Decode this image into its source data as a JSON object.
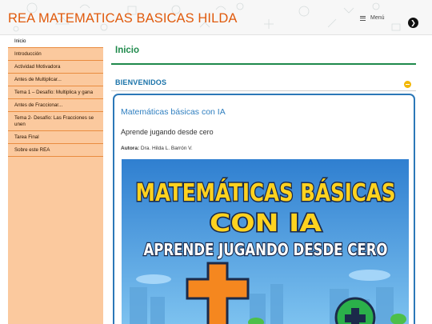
{
  "header": {
    "site_title": "REA MATEMATICAS BASICAS HILDA",
    "menu_label": "Menú",
    "next_icon": "arrow-right-icon"
  },
  "sidebar": {
    "items": [
      {
        "label": "Inicio",
        "active": true
      },
      {
        "label": "Introducción"
      },
      {
        "label": "Actividad Motivadora"
      },
      {
        "label": "Antes de Multiplicar..."
      },
      {
        "label": "Tema 1 – Desafío: Multiplica y gana"
      },
      {
        "label": "Antes de Fraccionar..."
      },
      {
        "label": "Tema 2- Desafío: Las Fracciones se unen"
      },
      {
        "label": "Tarea Final"
      },
      {
        "label": "Sobre este REA"
      }
    ]
  },
  "main": {
    "page_title": "Inicio",
    "section_title": "BIENVENIDOS",
    "card": {
      "title": "Matemáticas básicas con IA",
      "subtitle": "Aprende jugando desde cero",
      "author_label": "Autora:",
      "author_name": "Dra. Hilda L. Barrón V."
    },
    "cover": {
      "line1": "MATEMÁTICAS BÁSICAS",
      "line2": "CON IA",
      "line3": "APRENDE JUGANDO DESDE CERO"
    }
  },
  "colors": {
    "title_orange": "#e05a0c",
    "sidebar_bg": "#fbc99e",
    "green": "#1f8a4c",
    "blue": "#2c78b8",
    "cover_yellow": "#ffd21f",
    "cover_sky": "#3d8fd6"
  }
}
